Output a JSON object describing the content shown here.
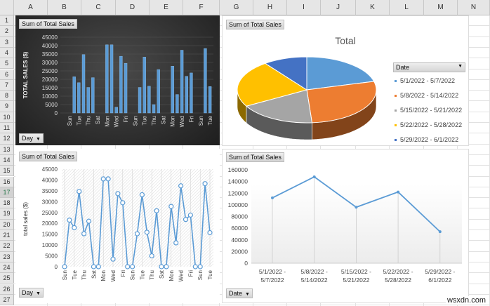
{
  "sheet": {
    "columns": [
      "A",
      "B",
      "C",
      "D",
      "E",
      "F",
      "G",
      "H",
      "I",
      "J",
      "K",
      "L",
      "M",
      "N"
    ],
    "rows": [
      "1",
      "2",
      "3",
      "4",
      "5",
      "6",
      "7",
      "8",
      "9",
      "10",
      "11",
      "12",
      "13",
      "14",
      "15",
      "16",
      "17",
      "18",
      "19",
      "20",
      "21",
      "22",
      "23",
      "24",
      "25",
      "26",
      "27"
    ],
    "selected_row": "17"
  },
  "colors": {
    "bar": "#5b9bd5",
    "orange": "#ed7d31",
    "gray": "#a5a5a5",
    "yellow": "#ffc000",
    "darkblue": "#4472c4",
    "dark_bg": "#2b2b2b"
  },
  "field_buttons": {
    "values": "Sum of Total Sales",
    "day": "Day",
    "date": "Date",
    "dropdown_icon": "caret-down"
  },
  "watermark": "wsxdn.com",
  "chart_data": [
    {
      "type": "bar",
      "ylabel": "TOTAL SALES ($)",
      "ylim": [
        0,
        45000
      ],
      "yticks": [
        0,
        5000,
        10000,
        15000,
        20000,
        25000,
        30000,
        35000,
        40000,
        45000
      ],
      "categories": [
        "Sun",
        "Mon",
        "Tue",
        "Wed",
        "Thu",
        "Fri",
        "Sat",
        "Sun",
        "Mon",
        "Tue",
        "Wed",
        "Thu",
        "Fri",
        "Sat",
        "Sun",
        "Mon",
        "Tue",
        "Wed",
        "Thu",
        "Fri",
        "Sat",
        "Sun",
        "Mon",
        "Tue",
        "Wed",
        "Thu",
        "Fri",
        "Sat",
        "Sun",
        "Mon",
        "Tue"
      ],
      "values": [
        0,
        21500,
        18000,
        34700,
        15200,
        21000,
        0,
        0,
        40500,
        40500,
        3500,
        33700,
        29500,
        0,
        0,
        15200,
        33200,
        15900,
        5000,
        25800,
        0,
        0,
        27800,
        11000,
        37300,
        21800,
        23800,
        0,
        0,
        38300,
        15700
      ],
      "grid": true,
      "background": "dark"
    },
    {
      "type": "pie",
      "title": "Total",
      "legend_title": "Date",
      "legend_position": "right",
      "categories": [
        "5/1/2022 - 5/7/2022",
        "5/8/2022 - 5/14/2022",
        "5/15/2022 - 5/21/2022",
        "5/22/2022 - 5/28/2022",
        "5/29/2022 - 6/1/2022"
      ],
      "values": [
        110400,
        147700,
        95100,
        121700,
        54000
      ],
      "colors": [
        "#5b9bd5",
        "#ed7d31",
        "#a5a5a5",
        "#ffc000",
        "#4472c4"
      ],
      "style": "3d"
    },
    {
      "type": "line",
      "ylabel": "total sales ($)",
      "ylim": [
        0,
        45000
      ],
      "yticks": [
        0,
        5000,
        10000,
        15000,
        20000,
        25000,
        30000,
        35000,
        40000,
        45000
      ],
      "categories": [
        "Sun",
        "Mon",
        "Tue",
        "Wed",
        "Thu",
        "Fri",
        "Sat",
        "Sun",
        "Mon",
        "Tue",
        "Wed",
        "Thu",
        "Fri",
        "Sat",
        "Sun",
        "Mon",
        "Tue",
        "Wed",
        "Thu",
        "Fri",
        "Sat",
        "Sun",
        "Mon",
        "Tue",
        "Wed",
        "Thu",
        "Fri",
        "Sat",
        "Sun",
        "Mon",
        "Tue"
      ],
      "values": [
        0,
        21500,
        18000,
        34700,
        15200,
        21000,
        0,
        0,
        40500,
        40500,
        3500,
        33700,
        29500,
        0,
        0,
        15200,
        33200,
        15900,
        5000,
        25800,
        0,
        0,
        27800,
        11000,
        37300,
        21800,
        23800,
        0,
        0,
        38300,
        15700
      ],
      "markers": "circle",
      "grid": true
    },
    {
      "type": "line",
      "ylim": [
        0,
        160000
      ],
      "yticks": [
        0,
        20000,
        40000,
        60000,
        80000,
        100000,
        120000,
        140000,
        160000
      ],
      "categories": [
        [
          "5/1/2022 -",
          "5/7/2022"
        ],
        [
          "5/8/2022 -",
          "5/14/2022"
        ],
        [
          "5/15/2022 -",
          "5/21/2022"
        ],
        [
          "5/22/2022 -",
          "5/28/2022"
        ],
        [
          "5/29/2022 -",
          "6/1/2022"
        ]
      ],
      "values": [
        112000,
        148000,
        96000,
        122000,
        54000
      ],
      "drop_lines": true
    }
  ]
}
